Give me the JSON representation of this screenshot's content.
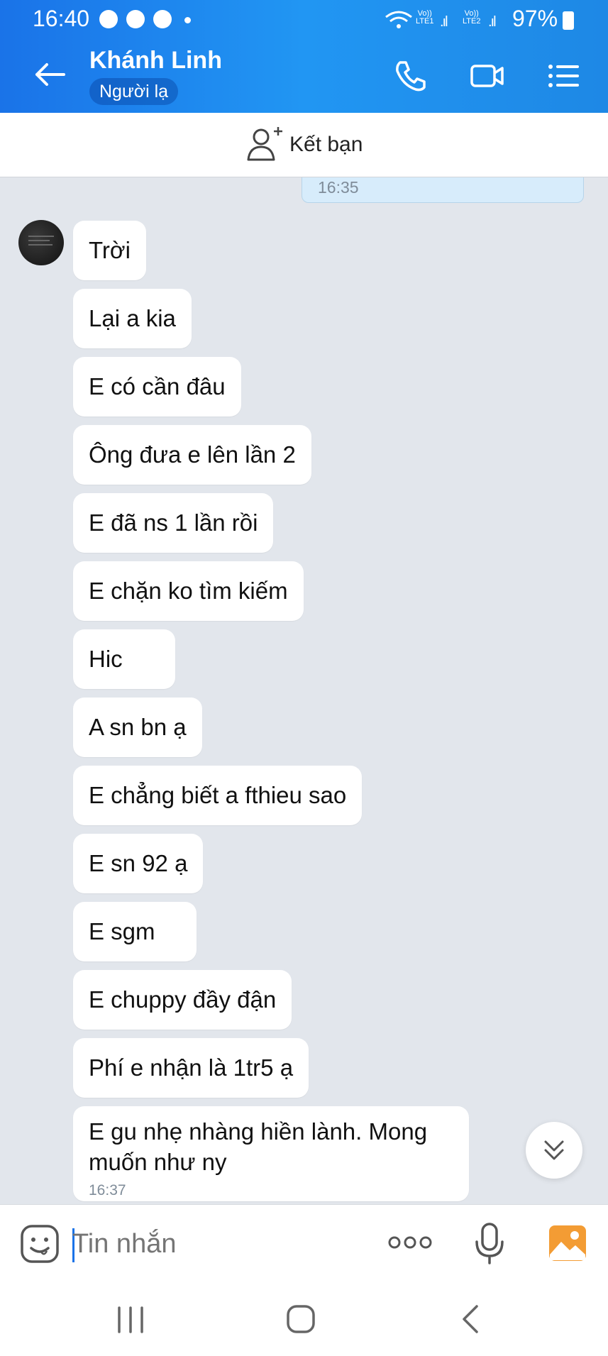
{
  "status_bar": {
    "time": "16:40",
    "sim1": "LTE1",
    "sim2": "LTE2",
    "volte": "Vo))",
    "battery": "97%"
  },
  "header": {
    "contact_name": "Khánh Linh",
    "badge": "Người lạ",
    "icons": [
      "back-arrow-icon",
      "phone-icon",
      "video-call-icon",
      "menu-icon"
    ],
    "accent_color": "#1a73e8"
  },
  "add_friend": {
    "label": "Kết bạn",
    "icon": "add-friend-icon"
  },
  "chat": {
    "previous_time": "16:35",
    "messages": [
      {
        "text": "Trời"
      },
      {
        "text": "Lại a kia"
      },
      {
        "text": "E có cần đâu"
      },
      {
        "text": "Ông đưa e lên lần 2"
      },
      {
        "text": "E đã ns 1 lần rồi"
      },
      {
        "text": "E chặn ko tìm kiếm"
      },
      {
        "text": "Hic"
      },
      {
        "text": "A sn bn ạ"
      },
      {
        "text": "E chẳng biết a fthieu sao"
      },
      {
        "text": "E sn 92 ạ"
      },
      {
        "text": "E sgm"
      },
      {
        "text": "E chuppy đầy đận"
      },
      {
        "text": "Phí e nhận là 1tr5 ạ"
      },
      {
        "text": "E gu nhẹ nhàng hiền lành. Mong muốn như ny",
        "time": "16:37"
      }
    ]
  },
  "composer": {
    "placeholder": "Tin nhắn",
    "icons": [
      "emoji-icon",
      "more-icon",
      "microphone-icon",
      "image-icon"
    ]
  },
  "nav_bar": {
    "icons": [
      "recents-icon",
      "home-icon",
      "back-icon"
    ]
  }
}
